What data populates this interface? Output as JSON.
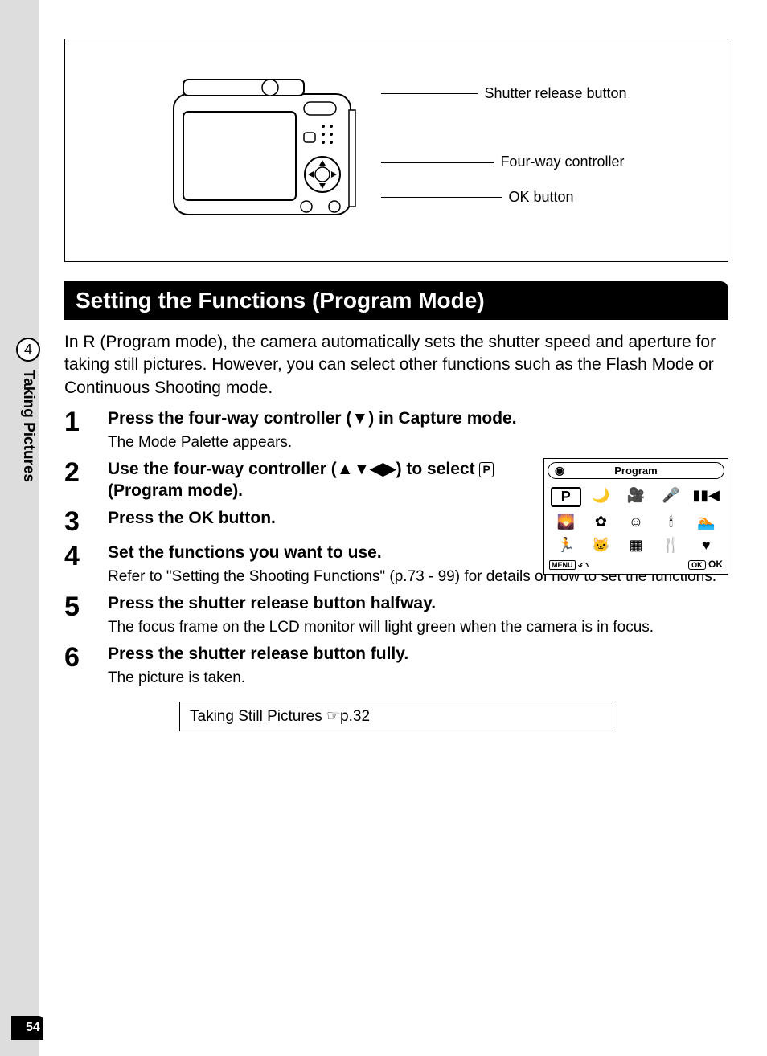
{
  "page_number": "54",
  "side_tab": {
    "chapter_num": "4",
    "chapter_title": "Taking Pictures"
  },
  "diagram": {
    "callouts": [
      "Shutter release button",
      "Four-way controller",
      "OK button"
    ]
  },
  "heading": "Setting the Functions (Program Mode)",
  "intro": "In R (Program mode), the camera automatically sets the shutter speed and aperture for taking still pictures. However, you can select other functions such as the Flash Mode or Continuous Shooting mode.",
  "steps": [
    {
      "num": "1",
      "title": "Press the four-way controller (▼) in Capture mode.",
      "desc": "The Mode Palette appears."
    },
    {
      "num": "2",
      "title_pre": "Use the four-way controller (▲▼◀▶) to select ",
      "title_icon": "P",
      "title_post": " (Program mode)."
    },
    {
      "num": "3",
      "title": "Press the OK button."
    },
    {
      "num": "4",
      "title": "Set the functions you want to use.",
      "desc": "Refer to \"Setting the Shooting Functions\" (p.73 - 99) for details of how to set the functions."
    },
    {
      "num": "5",
      "title": "Press the shutter release button halfway.",
      "desc": "The focus frame on the LCD monitor will light green when the camera is in focus."
    },
    {
      "num": "6",
      "title": "Press the shutter release button fully.",
      "desc": "The picture is taken."
    }
  ],
  "palette": {
    "title": "Program",
    "selected_icon": "P",
    "footer_menu": "MENU",
    "footer_ok_btn": "OK",
    "footer_ok_label": "OK"
  },
  "ref_box": "Taking Still Pictures ☞p.32"
}
